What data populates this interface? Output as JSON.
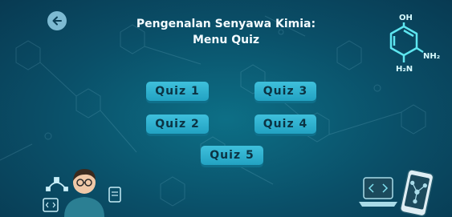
{
  "title": {
    "line1": "Pengenalan Senyawa Kimia:",
    "line2": "Menu Quiz"
  },
  "molecule": {
    "oh_label": "OH",
    "nh2_label": "NH₂",
    "h2n_label": "H₂N"
  },
  "quiz_buttons": [
    "Quiz 1",
    "Quiz 3",
    "Quiz 2",
    "Quiz 4",
    "Quiz 5"
  ],
  "icons": {
    "back": "arrow-left-icon"
  },
  "colors": {
    "background": "#0a4f68",
    "button": "#2fb2d0",
    "button_text": "#0b3343",
    "molecule": "#5ee6f0"
  }
}
